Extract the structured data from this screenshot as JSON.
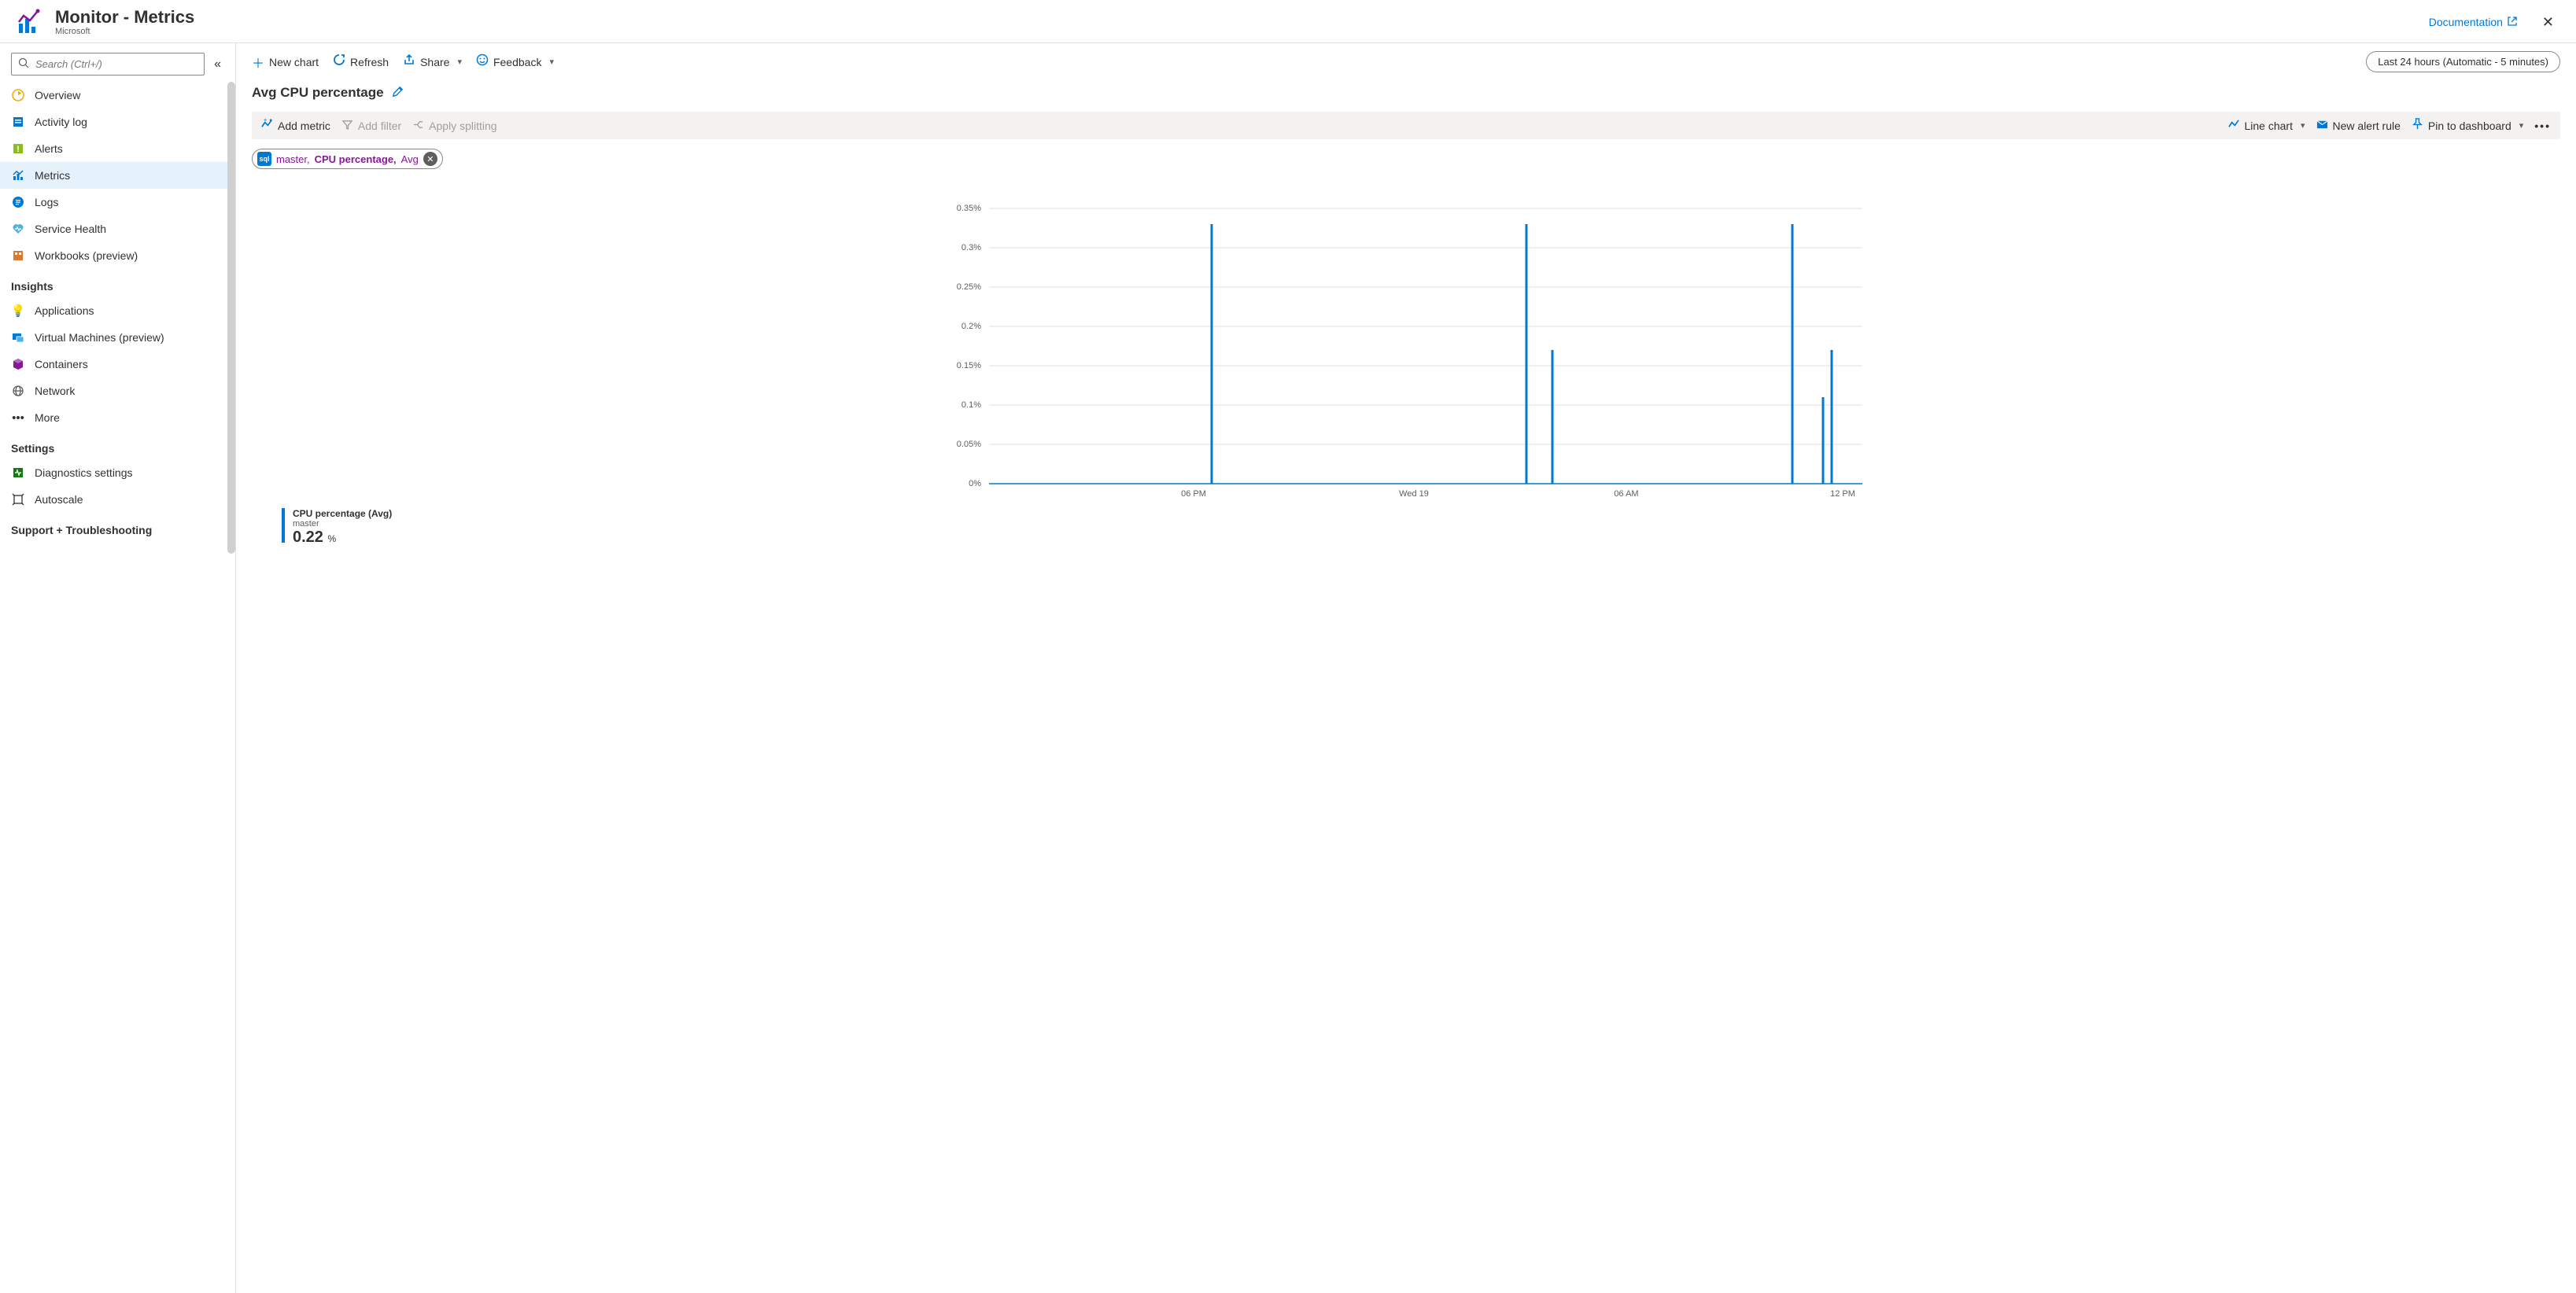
{
  "header": {
    "title": "Monitor - Metrics",
    "subtitle": "Microsoft",
    "documentation": "Documentation"
  },
  "sidebar": {
    "search_placeholder": "Search (Ctrl+/)",
    "items": [
      {
        "label": "Overview",
        "icon": "overview"
      },
      {
        "label": "Activity log",
        "icon": "activity"
      },
      {
        "label": "Alerts",
        "icon": "alerts"
      },
      {
        "label": "Metrics",
        "icon": "metrics",
        "active": true
      },
      {
        "label": "Logs",
        "icon": "logs"
      },
      {
        "label": "Service Health",
        "icon": "health"
      },
      {
        "label": "Workbooks (preview)",
        "icon": "workbooks"
      }
    ],
    "section_insights": "Insights",
    "insights": [
      {
        "label": "Applications",
        "icon": "apps"
      },
      {
        "label": "Virtual Machines (preview)",
        "icon": "vms"
      },
      {
        "label": "Containers",
        "icon": "containers"
      },
      {
        "label": "Network",
        "icon": "network"
      },
      {
        "label": "More",
        "icon": "more"
      }
    ],
    "section_settings": "Settings",
    "settings": [
      {
        "label": "Diagnostics settings",
        "icon": "diag"
      },
      {
        "label": "Autoscale",
        "icon": "autoscale"
      }
    ],
    "section_support": "Support + Troubleshooting"
  },
  "toolbar": {
    "new_chart": "New chart",
    "refresh": "Refresh",
    "share": "Share",
    "feedback": "Feedback",
    "time_range": "Last 24 hours (Automatic - 5 minutes)"
  },
  "chart": {
    "title": "Avg CPU percentage",
    "add_metric": "Add metric",
    "add_filter": "Add filter",
    "apply_splitting": "Apply splitting",
    "line_chart": "Line chart",
    "new_alert": "New alert rule",
    "pin": "Pin to dashboard",
    "chip_resource": "master,",
    "chip_metric": "CPU percentage,",
    "chip_agg": "Avg",
    "legend_name": "CPU percentage (Avg)",
    "legend_resource": "master",
    "legend_value": "0.22",
    "legend_unit": "%"
  },
  "chart_data": {
    "type": "line",
    "title": "Avg CPU percentage",
    "ylabel": "%",
    "ylim": [
      0,
      0.36
    ],
    "y_ticks": [
      "0%",
      "0.05%",
      "0.1%",
      "0.15%",
      "0.2%",
      "0.25%",
      "0.3%",
      "0.35%"
    ],
    "x_ticks": [
      "06 PM",
      "Wed 19",
      "06 AM",
      "12 PM"
    ],
    "series": [
      {
        "name": "CPU percentage (Avg)",
        "resource": "master",
        "aggregation": "Avg",
        "summary_value": 0.22,
        "spikes": [
          {
            "x_frac": 0.255,
            "value": 0.33
          },
          {
            "x_frac": 0.615,
            "value": 0.33
          },
          {
            "x_frac": 0.645,
            "value": 0.17
          },
          {
            "x_frac": 0.92,
            "value": 0.33
          },
          {
            "x_frac": 0.955,
            "value": 0.11
          },
          {
            "x_frac": 0.965,
            "value": 0.17
          }
        ],
        "baseline": 0
      }
    ]
  }
}
